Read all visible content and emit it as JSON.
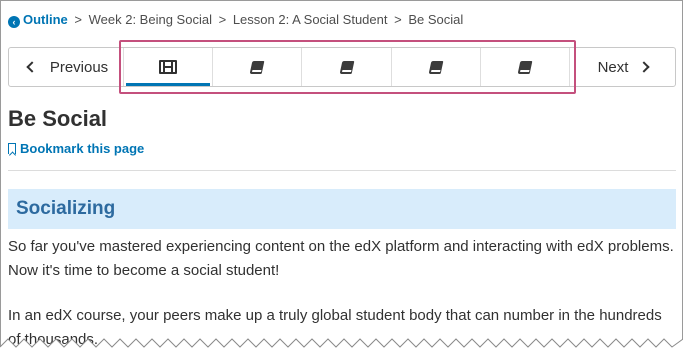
{
  "breadcrumb": {
    "outline_label": "Outline",
    "separator": ">",
    "items": [
      "Week 2: Being Social",
      "Lesson 2: A Social Student",
      "Be Social"
    ]
  },
  "sequence_nav": {
    "previous_label": "Previous",
    "next_label": "Next",
    "tabs": [
      {
        "icon": "video-icon",
        "active": true
      },
      {
        "icon": "book-icon",
        "active": false
      },
      {
        "icon": "book-icon",
        "active": false
      },
      {
        "icon": "book-icon",
        "active": false
      },
      {
        "icon": "book-icon",
        "active": false
      }
    ]
  },
  "unit": {
    "title": "Be Social",
    "bookmark_label": "Bookmark this page"
  },
  "content": {
    "section_heading": "Socializing",
    "paragraph1": "So far you've mastered experiencing content on the edX platform and interacting with edX problems. Now it's time to become a social student!",
    "paragraph2": "In an edX course, your peers make up a truly global student body that can number in the hundreds of thousands."
  },
  "colors": {
    "link_blue": "#0075b4",
    "heading_band": "#d8ecfb",
    "highlight_border": "#c4507d"
  }
}
